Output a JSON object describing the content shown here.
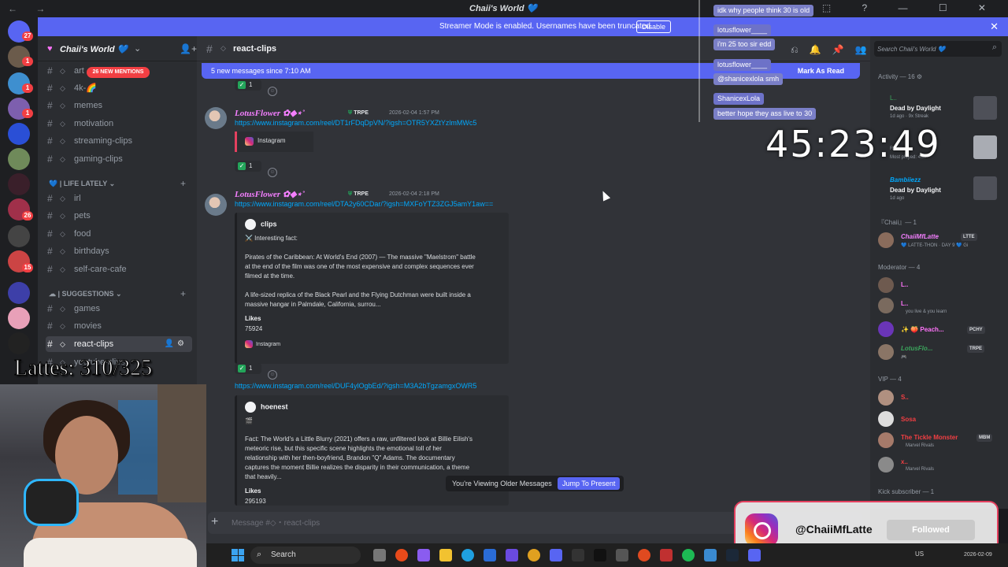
{
  "window": {
    "title": "Chaii's World 💙",
    "nav": "← →",
    "controls": "⬚ ? — ☐ ✕"
  },
  "banner": {
    "text": "Streamer Mode is enabled. Usernames have been truncated.",
    "button": "Disable",
    "close": "✕"
  },
  "server": {
    "name": "Chaii's World 💙",
    "icon": "heart-icon",
    "chevron": "⌄",
    "invite": "👤+"
  },
  "mentions_pill": "26 NEW MENTIONS",
  "guild_badges": [
    "27",
    "1",
    "1",
    "1",
    "26",
    "15"
  ],
  "channels": {
    "top": [
      {
        "name": "art"
      },
      {
        "name": "4k-🌈"
      },
      {
        "name": "memes"
      },
      {
        "name": "motivation"
      },
      {
        "name": "streaming-clips"
      },
      {
        "name": "gaming-clips"
      }
    ],
    "cat_lifelately": "💙 | LIFE LATELY ⌄",
    "lifelately": [
      {
        "name": "irl"
      },
      {
        "name": "pets"
      },
      {
        "name": "food"
      },
      {
        "name": "birthdays"
      },
      {
        "name": "self-care-cafe"
      }
    ],
    "cat_suggestions": "☁ | SUGGESTIONS ⌄",
    "suggestions": [
      {
        "name": "games"
      },
      {
        "name": "movies"
      },
      {
        "name": "react-clips"
      },
      {
        "name": "youtube-clips"
      }
    ],
    "plus": "+"
  },
  "chat": {
    "channel": "react-clips",
    "new_messages": "5 new messages since 7:10 AM",
    "mark_as_read": "Mark As Read",
    "older_text": "You're Viewing Older Messages",
    "jump": "Jump To Present",
    "composer_placeholder": "Message #◇・react-clips"
  },
  "messages": [
    {
      "author": "LotusFlower ✿◆⋆˚",
      "tag": "TRPE",
      "time": "2026-02-04 1:57 PM",
      "link": "https://www.instagram.com/reel/DT1rFDqDpVN/?igsh=OTR5YXZtYzlmMWc5",
      "embed_label": "Instagram",
      "reaction": "1"
    },
    {
      "author": "LotusFlower ✿◆⋆˚",
      "tag": "TRPE",
      "time": "2026-02-04 2:18 PM",
      "link": "https://www.instagram.com/reel/DTA2y60CDar/?igsh=MXFoYTZ3ZGJ5amY1aw==",
      "embed": {
        "author": "clips",
        "lines": [
          "⚔️ Interesting fact:",
          "Pirates of the Caribbean: At World's End (2007) — The massive \"Maelstrom\" battle",
          "at the end of the film was one of the most expensive and complex sequences ever",
          "filmed at the time.",
          "A life-sized replica of the Black Pearl and the Flying Dutchman were built inside a",
          "massive hangar in Palmdale, California, surrou..."
        ],
        "field_name": "Likes",
        "field_value": "75924",
        "footer": "Instagram"
      },
      "reaction": "1"
    },
    {
      "link": "https://www.instagram.com/reel/DUF4ylOgbEd/?igsh=M3A2bTgzamgxOWR5",
      "embed": {
        "author": "hoenest",
        "emoji": "🎬",
        "lines": [
          "Fact: The World's a Little Blurry (2021) offers a raw, unfiltered look at Billie Eilish's",
          "meteoric rise, but this specific scene highlights the emotional toll of her",
          "relationship with her then-boyfriend, Brandon \"Q\" Adams. The documentary",
          "captures the moment Billie realizes the disparity in their communication, a theme",
          "that heavily..."
        ],
        "field_name": "Likes",
        "field_value": "295193"
      }
    }
  ],
  "top_reaction": "1",
  "right_panel": {
    "search_placeholder": "Search Chaii's World 💙",
    "activity_header": "Activity — 16 ⚙",
    "activities": [
      {
        "user": "L..",
        "title": "Dead by Daylight",
        "sub": "1d ago · 9x Streak"
      },
      {
        "user": "Roblox",
        "title": "",
        "sub": "Most played: 4sh"
      },
      {
        "user": "Bambiiezz",
        "title": "Dead by Daylight",
        "sub": "1d ago"
      }
    ],
    "sections": [
      {
        "label": "『Chaii』— 1",
        "members": [
          {
            "name": "ChaiiMfLatte",
            "tag": "LTTE",
            "sub": "💙 LATTE-THON · DAY 9 💙 Gi",
            "color": "#f47fff"
          }
        ]
      },
      {
        "label": "Moderator — 4",
        "members": [
          {
            "name": "L..",
            "tag": "",
            "sub": "",
            "color": "#ff73fa"
          },
          {
            "name": "L..",
            "tag": "",
            "sub": "you live & you learn",
            "color": "#ff73fa"
          },
          {
            "name": "✨ 🍑 Peach...",
            "tag": "PCHY",
            "sub": "",
            "color": "#ff73fa"
          },
          {
            "name": "LotusFlo...",
            "tag": "TRPE",
            "sub": "🎮",
            "color": "#3ba55c"
          }
        ]
      },
      {
        "label": "VIP — 4",
        "members": [
          {
            "name": "S..",
            "tag": "",
            "sub": "",
            "color": "#f23f43"
          },
          {
            "name": "Sosa",
            "tag": "",
            "sub": "",
            "color": "#f23f43"
          },
          {
            "name": "The Tickle Monster",
            "tag": "MBM",
            "sub": "Marvel Rivals",
            "color": "#f23f43"
          },
          {
            "name": "x..",
            "tag": "",
            "sub": "Marvel Rivals",
            "color": "#f23f43"
          }
        ]
      },
      {
        "label": "Kick subscriber — 1",
        "members": []
      }
    ]
  },
  "overlay_chat": [
    {
      "kind": "msg",
      "text": "idk why people think 30 is old"
    },
    {
      "kind": "name",
      "text": "lotusflower____"
    },
    {
      "kind": "msg",
      "text": "i'm 25 too sir edd"
    },
    {
      "kind": "name",
      "text": "lotusflower____"
    },
    {
      "kind": "msg",
      "text": "@shanicexlola smh"
    },
    {
      "kind": "name",
      "text": "ShanicexLola"
    },
    {
      "kind": "msg",
      "text": "better hope they ass live to 30"
    }
  ],
  "timer": "45:23:49",
  "lattes": "Lattes: 310/325",
  "follow": {
    "handle": "@ChaiiMfLatte",
    "button": "Followed"
  },
  "taskbar": {
    "search": "Search",
    "tray": "US",
    "date": "2026-02-09"
  },
  "colors": {
    "accent": "#5865f2",
    "username": "#f47fff",
    "link": "#00a8fc",
    "mention_red": "#f23f43"
  }
}
